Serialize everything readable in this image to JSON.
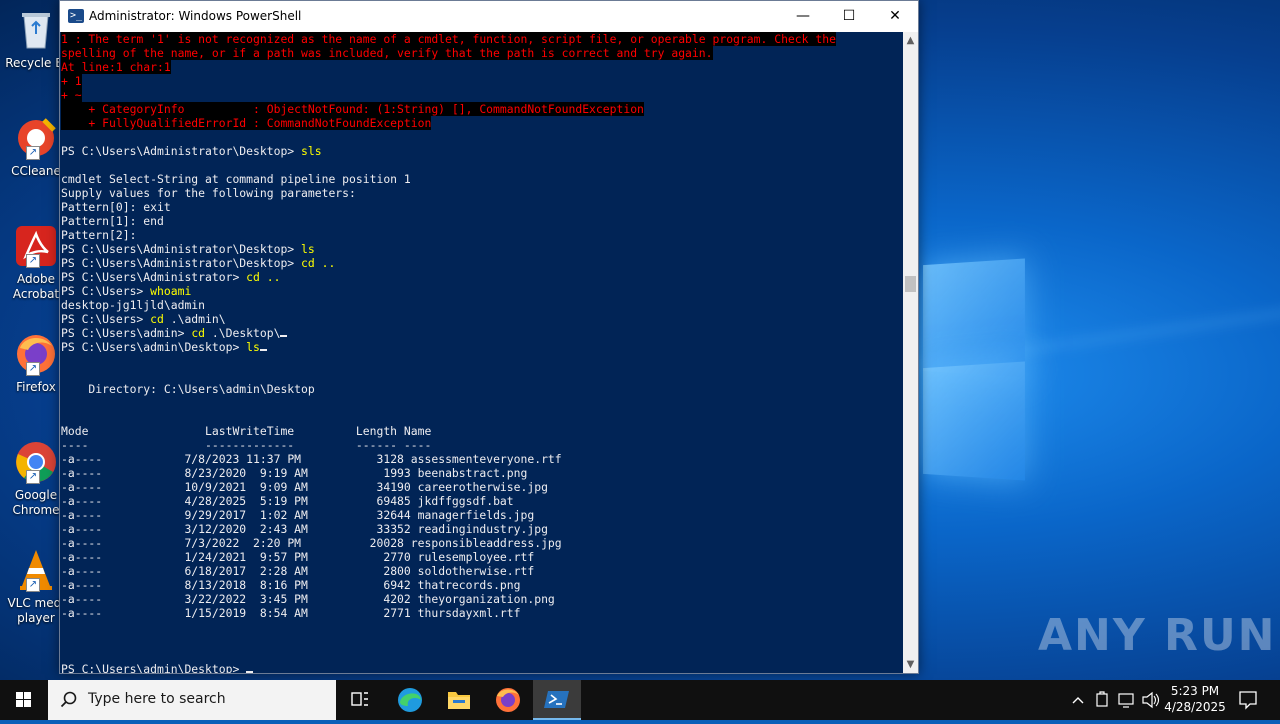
{
  "window": {
    "title": "Administrator: Windows PowerShell",
    "minimize": "—",
    "maximize": "☐",
    "close": "✕"
  },
  "desktop_icons": [
    {
      "label": "Recycle Bin",
      "label_shown": "Recycle Bi"
    },
    {
      "label": "CCleaner",
      "label_shown": "CCleane"
    },
    {
      "label": "Adobe Acrobat",
      "label_shown": "Adobe\nAcrobat"
    },
    {
      "label": "Firefox",
      "label_shown": "Firefox"
    },
    {
      "label": "Google Chrome",
      "label_shown": "Google\nChrome"
    },
    {
      "label": "VLC media player",
      "label_shown": "VLC medi\nplayer"
    }
  ],
  "console": {
    "error_lines": [
      "1 : The term '1' is not recognized as the name of a cmdlet, function, script file, or operable program. Check the",
      "spelling of the name, or if a path was included, verify that the path is correct and try again.",
      "At line:1 char:1",
      "+ 1",
      "+ ~",
      "    + CategoryInfo          : ObjectNotFound: (1:String) [], CommandNotFoundException",
      "    + FullyQualifiedErrorId : CommandNotFoundException"
    ],
    "session": [
      {
        "prompt": "PS C:\\Users\\Administrator\\Desktop> ",
        "cmd": "sls"
      },
      {
        "text": ""
      },
      {
        "text": "cmdlet Select-String at command pipeline position 1"
      },
      {
        "text": "Supply values for the following parameters:"
      },
      {
        "text": "Pattern[0]: exit"
      },
      {
        "text": "Pattern[1]: end"
      },
      {
        "text": "Pattern[2]:"
      },
      {
        "prompt": "PS C:\\Users\\Administrator\\Desktop> ",
        "cmd": "ls"
      },
      {
        "prompt": "PS C:\\Users\\Administrator\\Desktop> ",
        "cmd": "cd .."
      },
      {
        "prompt": "PS C:\\Users\\Administrator> ",
        "cmd": "cd .."
      },
      {
        "prompt": "PS C:\\Users> ",
        "cmd": "whoami"
      },
      {
        "text": "desktop-jg1ljld\\admin"
      },
      {
        "prompt": "PS C:\\Users> ",
        "cmd": "cd",
        "arg": " .\\admin\\"
      },
      {
        "prompt": "PS C:\\Users\\admin> ",
        "cmd": "cd",
        "arg": " .\\Desktop\\",
        "cursor": true
      },
      {
        "prompt": "PS C:\\Users\\admin\\Desktop> ",
        "cmd": "ls",
        "cursor": true
      }
    ],
    "directory_line": "    Directory: C:\\Users\\admin\\Desktop",
    "listing_header": "Mode                 LastWriteTime         Length Name",
    "listing_rule": "----                 -------------         ------ ----",
    "files": [
      {
        "mode": "-a----",
        "date": "7/8/2023",
        "time": "11:37 PM",
        "length": "3128",
        "name": "assessmenteveryone.rtf"
      },
      {
        "mode": "-a----",
        "date": "8/23/2020",
        "time": "9:19 AM",
        "length": "1993",
        "name": "beenabstract.png"
      },
      {
        "mode": "-a----",
        "date": "10/9/2021",
        "time": "9:09 AM",
        "length": "34190",
        "name": "careerotherwise.jpg"
      },
      {
        "mode": "-a----",
        "date": "4/28/2025",
        "time": "5:19 PM",
        "length": "69485",
        "name": "jkdffggsdf.bat"
      },
      {
        "mode": "-a----",
        "date": "9/29/2017",
        "time": "1:02 AM",
        "length": "32644",
        "name": "managerfields.jpg"
      },
      {
        "mode": "-a----",
        "date": "3/12/2020",
        "time": "2:43 AM",
        "length": "33352",
        "name": "readingindustry.jpg"
      },
      {
        "mode": "-a----",
        "date": "7/3/2022",
        "time": "2:20 PM",
        "length": "20028",
        "name": "responsibleaddress.jpg"
      },
      {
        "mode": "-a----",
        "date": "1/24/2021",
        "time": "9:57 PM",
        "length": "2770",
        "name": "rulesemployee.rtf"
      },
      {
        "mode": "-a----",
        "date": "6/18/2017",
        "time": "2:28 AM",
        "length": "2800",
        "name": "soldotherwise.rtf"
      },
      {
        "mode": "-a----",
        "date": "8/13/2018",
        "time": "8:16 PM",
        "length": "6942",
        "name": "thatrecords.png"
      },
      {
        "mode": "-a----",
        "date": "3/22/2022",
        "time": "3:45 PM",
        "length": "4202",
        "name": "theyorganization.png"
      },
      {
        "mode": "-a----",
        "date": "1/15/2019",
        "time": "8:54 AM",
        "length": "2771",
        "name": "thursdayxml.rtf"
      }
    ],
    "final_prompt": "PS C:\\Users\\admin\\Desktop> "
  },
  "taskbar": {
    "search_placeholder": "Type here to search",
    "time": "5:23 PM",
    "date": "4/28/2025",
    "pinned": [
      "task-view-icon",
      "edge-icon",
      "file-explorer-icon",
      "firefox-icon",
      "powershell-icon"
    ]
  },
  "watermark": "ANY RUN",
  "colors": {
    "console_bg": "#012456",
    "console_fg": "#eeedf0",
    "error_fg": "#ff0000",
    "command_fg": "#ffff00"
  }
}
